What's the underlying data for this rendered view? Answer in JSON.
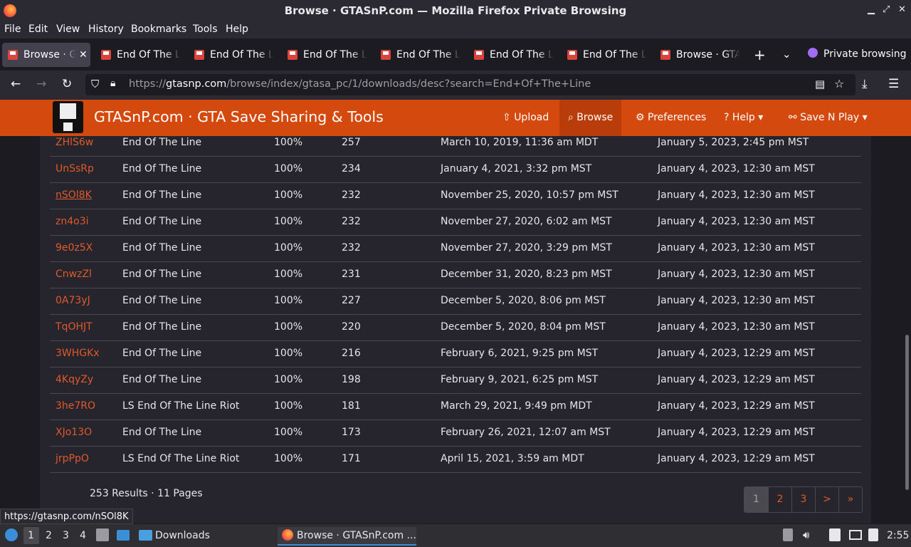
{
  "window": {
    "title": "Browse · GTASnP.com — Mozilla Firefox Private Browsing"
  },
  "menu": [
    "File",
    "Edit",
    "View",
    "History",
    "Bookmarks",
    "Tools",
    "Help"
  ],
  "tabs": [
    {
      "label": "Browse · GTASnP.com"
    },
    {
      "label": "End Of The Line"
    },
    {
      "label": "End Of The Line"
    },
    {
      "label": "End Of The Line"
    },
    {
      "label": "End Of The Line"
    },
    {
      "label": "End Of The Line"
    },
    {
      "label": "End Of The Line"
    },
    {
      "label": "Browse · GTASnP.com"
    }
  ],
  "private_label": "Private browsing",
  "url": {
    "prefix": "https://",
    "host": "gtasnp.com",
    "path": "/browse/index/gtasa_pc/1/downloads/desc?search=End+Of+The+Line"
  },
  "site": {
    "brand": "GTASnP.com · GTA Save Sharing & Tools",
    "nav": [
      "Upload",
      "Browse",
      "Preferences",
      "Help",
      "Save N Play"
    ]
  },
  "table": [
    {
      "id": "ZHlS6w",
      "name": "End Of The Line",
      "pct": "100%",
      "dl": "257",
      "created": "March 10, 2019, 11:36 am MDT",
      "updated": "January 5, 2023, 2:45 pm MST"
    },
    {
      "id": "UnSsRp",
      "name": "End Of The Line",
      "pct": "100%",
      "dl": "234",
      "created": "January 4, 2021, 3:32 pm MST",
      "updated": "January 4, 2023, 12:30 am MST"
    },
    {
      "id": "nSOl8K",
      "name": "End Of The Line",
      "pct": "100%",
      "dl": "232",
      "created": "November 25, 2020, 10:57 pm MST",
      "updated": "January 4, 2023, 12:30 am MST"
    },
    {
      "id": "zn4o3i",
      "name": "End Of The Line",
      "pct": "100%",
      "dl": "232",
      "created": "November 27, 2020, 6:02 am MST",
      "updated": "January 4, 2023, 12:30 am MST"
    },
    {
      "id": "9e0z5X",
      "name": "End Of The Line",
      "pct": "100%",
      "dl": "232",
      "created": "November 27, 2020, 3:29 pm MST",
      "updated": "January 4, 2023, 12:30 am MST"
    },
    {
      "id": "CnwzZl",
      "name": "End Of The Line",
      "pct": "100%",
      "dl": "231",
      "created": "December 31, 2020, 8:23 pm MST",
      "updated": "January 4, 2023, 12:30 am MST"
    },
    {
      "id": "0A73yJ",
      "name": "End Of The Line",
      "pct": "100%",
      "dl": "227",
      "created": "December 5, 2020, 8:06 pm MST",
      "updated": "January 4, 2023, 12:30 am MST"
    },
    {
      "id": "TqOHJT",
      "name": "End Of The Line",
      "pct": "100%",
      "dl": "220",
      "created": "December 5, 2020, 8:04 pm MST",
      "updated": "January 4, 2023, 12:30 am MST"
    },
    {
      "id": "3WHGKx",
      "name": "End Of The Line",
      "pct": "100%",
      "dl": "216",
      "created": "February 6, 2021, 9:25 pm MST",
      "updated": "January 4, 2023, 12:29 am MST"
    },
    {
      "id": "4KqyZy",
      "name": "End Of The Line",
      "pct": "100%",
      "dl": "198",
      "created": "February 9, 2021, 6:25 pm MST",
      "updated": "January 4, 2023, 12:29 am MST"
    },
    {
      "id": "3he7RO",
      "name": "LS End Of The Line Riot",
      "pct": "100%",
      "dl": "181",
      "created": "March 29, 2021, 9:49 pm MDT",
      "updated": "January 4, 2023, 12:29 am MST"
    },
    {
      "id": "XJo13O",
      "name": "End Of The Line",
      "pct": "100%",
      "dl": "173",
      "created": "February 26, 2021, 12:07 am MST",
      "updated": "January 4, 2023, 12:29 am MST"
    },
    {
      "id": "jrpPpO",
      "name": "LS End Of The Line Riot",
      "pct": "100%",
      "dl": "171",
      "created": "April 15, 2021, 3:59 am MDT",
      "updated": "January 4, 2023, 12:29 am MST"
    }
  ],
  "results_text": "253 Results · 11 Pages",
  "pager": [
    "1",
    "2",
    "3",
    ">",
    "»"
  ],
  "status_url": "https://gtasnp.com/nSOl8K",
  "taskbar": {
    "workspaces": [
      "1",
      "2",
      "3",
      "4"
    ],
    "folder": "Downloads",
    "window": "Browse · GTASnP.com ...",
    "clock": "2:55"
  }
}
